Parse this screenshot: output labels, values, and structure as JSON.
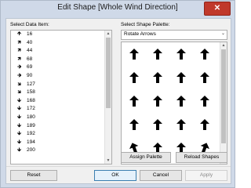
{
  "window": {
    "title": "Edit Shape [Whole Wind Direction]",
    "close_label": "✕"
  },
  "left": {
    "label": "Select Data Item:",
    "items": [
      {
        "value": "16",
        "icon": "arrow-north-icon",
        "glyph": "🡹"
      },
      {
        "value": "40",
        "icon": "arrow-northeast-icon",
        "glyph": "🡽"
      },
      {
        "value": "44",
        "icon": "arrow-northeast-icon",
        "glyph": "🡽"
      },
      {
        "value": "68",
        "icon": "arrow-east-northeast-icon",
        "glyph": "🡽"
      },
      {
        "value": "69",
        "icon": "arrow-east-icon",
        "glyph": "🡺"
      },
      {
        "value": "90",
        "icon": "arrow-east-icon",
        "glyph": "🡺"
      },
      {
        "value": "127",
        "icon": "arrow-southeast-icon",
        "glyph": "🡾"
      },
      {
        "value": "158",
        "icon": "arrow-south-southeast-icon",
        "glyph": "🡾"
      },
      {
        "value": "168",
        "icon": "arrow-south-icon",
        "glyph": "🡻"
      },
      {
        "value": "172",
        "icon": "arrow-south-icon",
        "glyph": "🡻"
      },
      {
        "value": "180",
        "icon": "arrow-south-icon",
        "glyph": "🡻"
      },
      {
        "value": "189",
        "icon": "arrow-south-icon",
        "glyph": "🡻"
      },
      {
        "value": "192",
        "icon": "arrow-south-icon",
        "glyph": "🡻"
      },
      {
        "value": "194",
        "icon": "arrow-south-icon",
        "glyph": "🡻"
      },
      {
        "value": "200",
        "icon": "arrow-south-icon",
        "glyph": "🡻"
      }
    ]
  },
  "right": {
    "label": "Select Shape Palette:",
    "palette_selected": "Rotate Arrows",
    "shapes": [
      {
        "icon": "arrow-up-icon",
        "angle": 0
      },
      {
        "icon": "arrow-up-icon",
        "angle": 0
      },
      {
        "icon": "arrow-up-icon",
        "angle": 0
      },
      {
        "icon": "arrow-up-icon",
        "angle": 0
      },
      {
        "icon": "arrow-up-icon",
        "angle": 0
      },
      {
        "icon": "arrow-up-icon",
        "angle": 0
      },
      {
        "icon": "arrow-up-icon",
        "angle": 0
      },
      {
        "icon": "arrow-up-icon",
        "angle": 0
      },
      {
        "icon": "arrow-up-icon",
        "angle": 0
      },
      {
        "icon": "arrow-up-icon",
        "angle": 0
      },
      {
        "icon": "arrow-up-icon",
        "angle": 0
      },
      {
        "icon": "arrow-up-icon",
        "angle": 0
      },
      {
        "icon": "arrow-up-icon",
        "angle": 0
      },
      {
        "icon": "arrow-up-icon",
        "angle": 0
      },
      {
        "icon": "arrow-up-icon",
        "angle": 0
      },
      {
        "icon": "arrow-up-icon",
        "angle": 0
      },
      {
        "icon": "arrow-up-left-icon",
        "angle": -20
      },
      {
        "icon": "arrow-up-icon",
        "angle": 0
      },
      {
        "icon": "arrow-up-icon",
        "angle": 0
      },
      {
        "icon": "arrow-up-right-icon",
        "angle": 20
      }
    ],
    "assign_palette_label": "Assign Palette",
    "reload_shapes_label": "Reload Shapes"
  },
  "footer": {
    "reset_label": "Reset",
    "ok_label": "OK",
    "cancel_label": "Cancel",
    "apply_label": "Apply"
  }
}
